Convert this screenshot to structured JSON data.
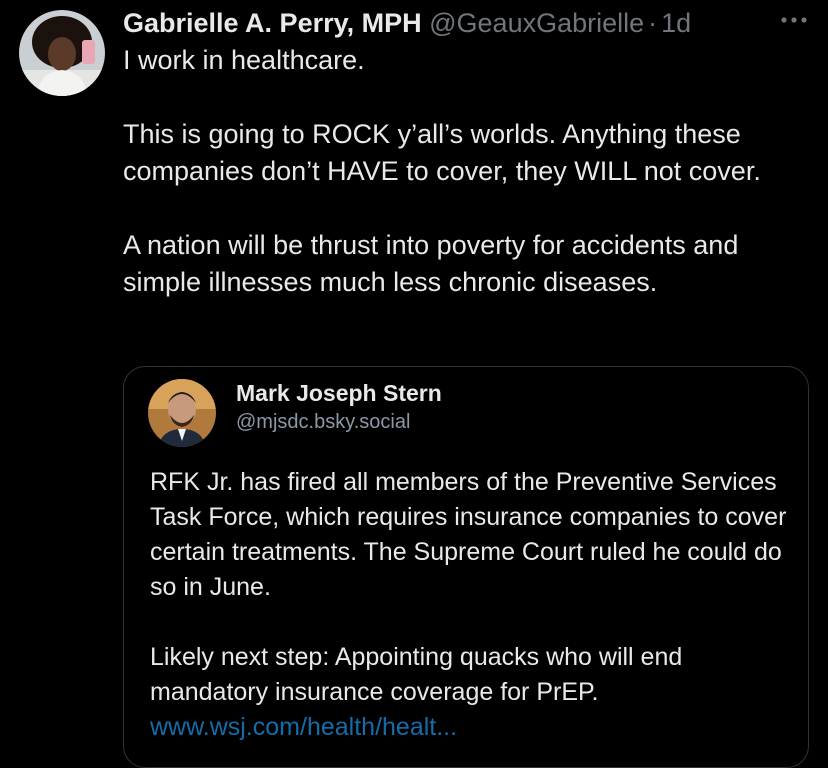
{
  "tweet": {
    "author": {
      "name": "Gabrielle A. Perry, MPH",
      "handle": "@GeauxGabrielle",
      "separator": "·",
      "time": "1d"
    },
    "more_icon": "more-horizontal-icon",
    "text": {
      "p1": "I work in healthcare.",
      "p2": "This is going to ROCK y’all’s worlds. Anything these companies don’t HAVE to cover, they WILL not cover.",
      "p3": "A nation will be thrust into poverty for accidents and simple illnesses much less chronic diseases."
    }
  },
  "quote": {
    "author": {
      "name": "Mark Joseph Stern",
      "handle": "@mjsdc.bsky.social"
    },
    "text": {
      "p1": "RFK Jr. has fired all members of the Preventive Services Task Force, which requires insurance companies to cover certain treatments. The Supreme Court ruled he could do so in June.",
      "p2": "Likely next step: Appointing quacks who will end mandatory insurance coverage for PrEP.",
      "link": "www.wsj.com/health/healt..."
    }
  },
  "colors": {
    "background": "#000000",
    "primary_text": "#e7e9ea",
    "secondary_text": "#71767b",
    "border": "#2f3336",
    "link": "#1d9bf0"
  }
}
